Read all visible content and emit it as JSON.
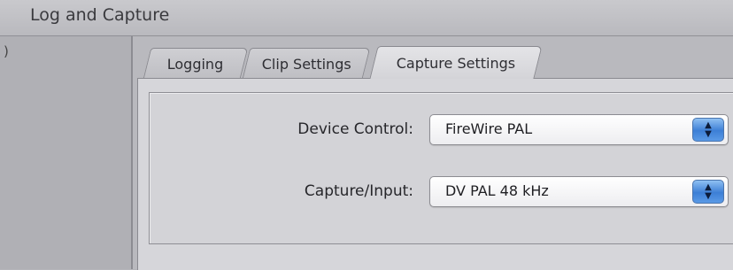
{
  "window": {
    "title": "Log and Capture",
    "left_glyph": ")"
  },
  "tabs": [
    {
      "label": "Logging",
      "active": false
    },
    {
      "label": "Clip Settings",
      "active": false
    },
    {
      "label": "Capture Settings",
      "active": true
    }
  ],
  "capture_settings": {
    "device_control": {
      "label": "Device Control:",
      "selected": "FireWire PAL"
    },
    "capture_input": {
      "label": "Capture/Input:",
      "selected": "DV PAL 48 kHz"
    }
  },
  "icons": {
    "stepper": "up-down-arrows-icon"
  },
  "colors": {
    "accent_stepper": "#3d7fd6",
    "panel_background": "#d6d6da"
  }
}
